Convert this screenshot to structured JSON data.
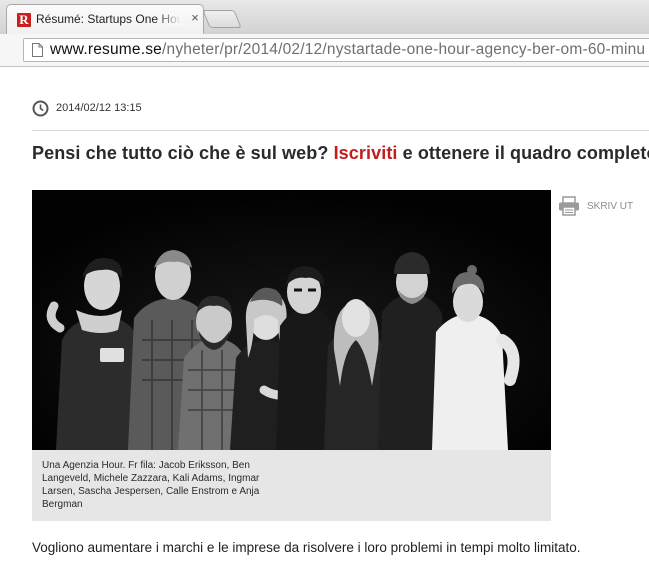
{
  "browser": {
    "tab": {
      "favicon_letter": "R",
      "title": "Résumé: Startups One Hour",
      "close_glyph": "×"
    },
    "address_bar": {
      "domain": "www.resume.se",
      "path": "/nyheter/pr/2014/02/12/nystartade-one-hour-agency-ber-om-60-minu"
    }
  },
  "article": {
    "date": "2014/02/12 13:15",
    "headline": {
      "before": "Pensi che tutto ciò che è sul web? ",
      "link": "Iscriviti",
      "after": " e ottenere il quadro completo"
    },
    "print_label": "SKRIV UT",
    "photo_caption": "Una Agenzia Hour. Fr fila: Jacob Eriksson, Ben Langeveld, Michele Zazzara, Kali Adams, Ingmar Larsen, Sascha Jespersen, Calle Enstrom e Anja Bergman",
    "body": "Vogliono aumentare i marchi e le imprese da risolvere i loro problemi in tempi molto limitato."
  },
  "colors": {
    "brand_red": "#c11d1d",
    "favicon_red": "#c81f1f"
  },
  "icons": [
    "page-icon",
    "clock-icon",
    "printer-icon",
    "close-icon",
    "back-icon"
  ]
}
